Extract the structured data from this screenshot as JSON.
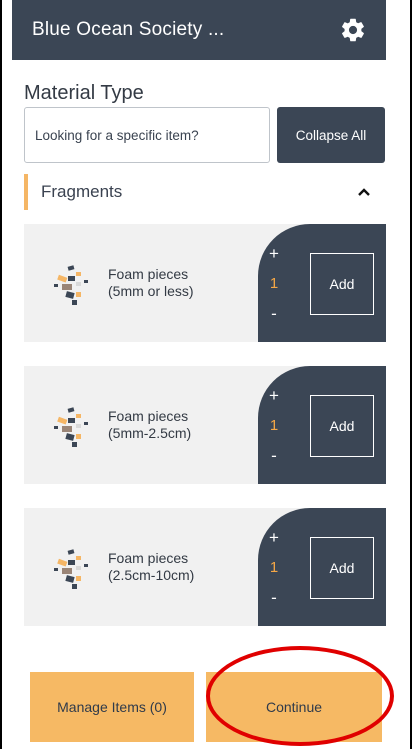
{
  "header": {
    "title": "Blue Ocean Society ...",
    "settings_icon": "gear-icon"
  },
  "material": {
    "section_title": "Material Type",
    "search_placeholder": "Looking for a specific item?",
    "collapse_label": "Collapse All"
  },
  "category": {
    "label": "Fragments",
    "caret_icon": "chevron-up-icon",
    "accent_color": "#f5b665"
  },
  "items": [
    {
      "name_line1": "Foam pieces",
      "name_line2": "(5mm or less)",
      "plus": "+",
      "quantity": "1",
      "minus": "-",
      "add_label": "Add"
    },
    {
      "name_line1": "Foam pieces",
      "name_line2": "(5mm-2.5cm)",
      "plus": "+",
      "quantity": "1",
      "minus": "-",
      "add_label": "Add"
    },
    {
      "name_line1": "Foam pieces",
      "name_line2": "(2.5cm-10cm)",
      "plus": "+",
      "quantity": "1",
      "minus": "-",
      "add_label": "Add"
    }
  ],
  "footer": {
    "manage_label": "Manage Items (0)",
    "continue_label": "Continue"
  },
  "colors": {
    "primary": "#3b4655",
    "accent": "#f6b964",
    "highlight": "#e00000"
  }
}
